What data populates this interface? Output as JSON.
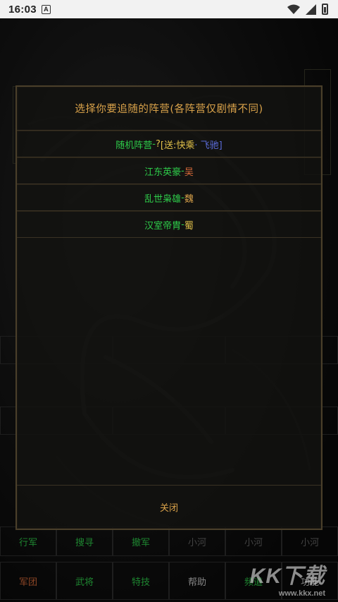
{
  "status_bar": {
    "time": "16:03",
    "badge": "A",
    "icons": [
      "wifi-icon",
      "signal-icon",
      "battery-icon"
    ]
  },
  "background": {
    "bottom_row1": [
      "行军",
      "搜寻",
      "撤军",
      "小河",
      "小河",
      "小河"
    ],
    "bottom_row2": [
      "军团",
      "武将",
      "特技",
      "帮助",
      "频道",
      "功能"
    ],
    "colors": {
      "row1": [
        "#2ecc4a",
        "#2ecc4a",
        "#2ecc4a",
        "#888888",
        "#888888",
        "#888888"
      ],
      "row2": [
        "#d86b3a",
        "#2ecc4a",
        "#2ecc4a",
        "#cccccc",
        "#2ecc4a",
        "#cccccc"
      ]
    }
  },
  "dialog": {
    "title": "选择你要追随的阵营(各阵营仅剧情不同)",
    "options": [
      {
        "label": "随机阵营",
        "dash": " - ",
        "suffix_a": "?",
        "suffix_b": "[送:快",
        "suffix_c": "乘",
        "suffix_d": " · 飞驰]"
      },
      {
        "label": "江东英豪",
        "dash": " - ",
        "faction": "吴"
      },
      {
        "label": "乱世枭雄",
        "dash": " - ",
        "faction": "魏"
      },
      {
        "label": "汉室帝胄",
        "dash": " - ",
        "faction": "蜀"
      }
    ],
    "close_label": "关闭"
  },
  "watermark": {
    "big": "KK下载",
    "small": "www.kkx.net"
  },
  "theme": {
    "gold": "#d9a24a",
    "green": "#2ecc4a",
    "border": "#4a3f2a"
  }
}
